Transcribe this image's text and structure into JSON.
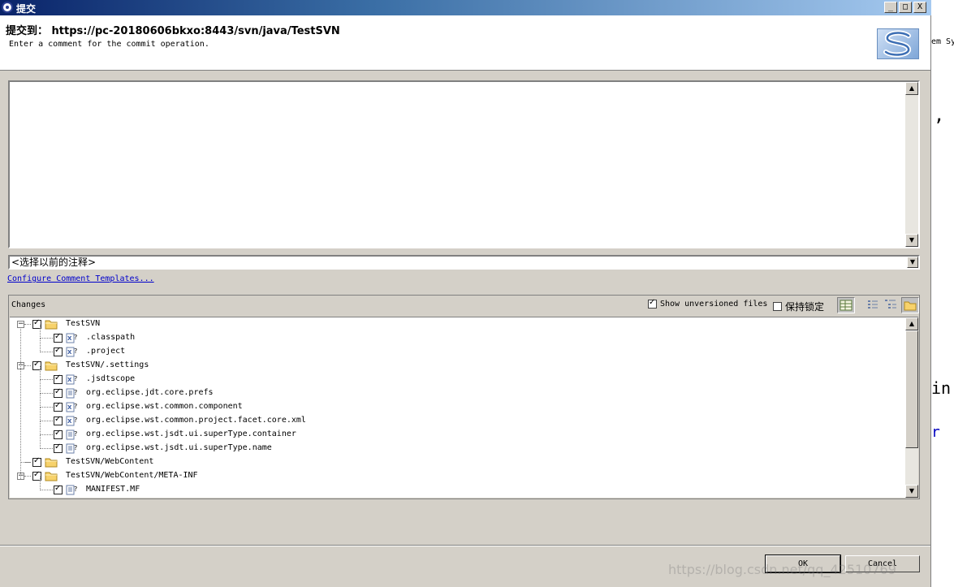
{
  "window": {
    "title": "提交",
    "controls": [
      "_",
      "□",
      "X"
    ]
  },
  "header": {
    "title": "提交到： https://pc-20180606bkxo:8443/svn/java/TestSVN",
    "subtitle": "Enter a comment for the commit operation."
  },
  "comment": {
    "history_placeholder": "<选择以前的注释>",
    "templates_link": "Configure Comment Templates..."
  },
  "changes": {
    "label": "Changes",
    "show_unversioned": {
      "label": "Show unversioned files",
      "checked": true
    },
    "keep_locks": {
      "label": "保持锁定",
      "checked": false
    },
    "tree": [
      {
        "label": "TestSVN",
        "type": "folder",
        "level": 0,
        "expanded": true,
        "checked": true
      },
      {
        "label": ".classpath",
        "type": "xml-file",
        "level": 1,
        "checked": true
      },
      {
        "label": ".project",
        "type": "xml-file",
        "level": 1,
        "checked": true
      },
      {
        "label": "TestSVN/.settings",
        "type": "folder",
        "level": 0,
        "expanded": true,
        "checked": true
      },
      {
        "label": ".jsdtscope",
        "type": "xml-file",
        "level": 1,
        "checked": true
      },
      {
        "label": "org.eclipse.jdt.core.prefs",
        "type": "text-file",
        "level": 1,
        "checked": true
      },
      {
        "label": "org.eclipse.wst.common.component",
        "type": "xml-file",
        "level": 1,
        "checked": true
      },
      {
        "label": "org.eclipse.wst.common.project.facet.core.xml",
        "type": "xml-file",
        "level": 1,
        "checked": true
      },
      {
        "label": "org.eclipse.wst.jsdt.ui.superType.container",
        "type": "text-file",
        "level": 1,
        "checked": true
      },
      {
        "label": "org.eclipse.wst.jsdt.ui.superType.name",
        "type": "text-file",
        "level": 1,
        "checked": true
      },
      {
        "label": "TestSVN/WebContent",
        "type": "folder",
        "level": 0,
        "expanded": false,
        "checked": true
      },
      {
        "label": "TestSVN/WebContent/META-INF",
        "type": "folder",
        "level": 0,
        "expanded": true,
        "checked": true
      },
      {
        "label": "MANIFEST.MF",
        "type": "text-file",
        "level": 1,
        "checked": true
      }
    ]
  },
  "buttons": {
    "ok": "OK",
    "cancel": "Cancel"
  },
  "background_fragments": {
    "top": "em Sy",
    "comma": ",",
    "mid": "in",
    "low": "r"
  },
  "watermark": "https://blog.csdn.net/qq_42510769"
}
